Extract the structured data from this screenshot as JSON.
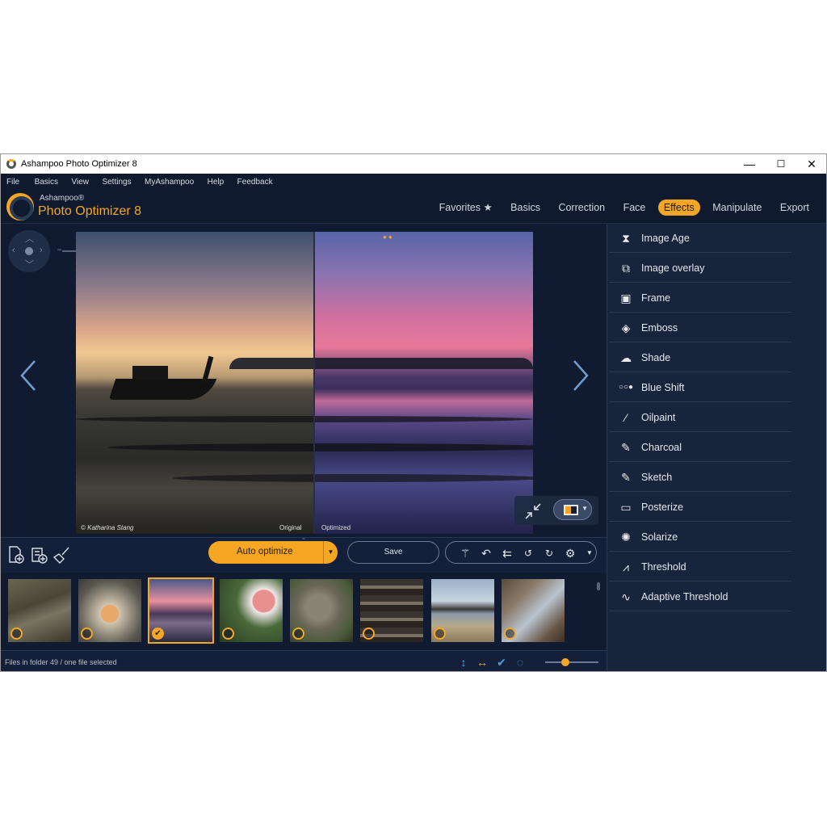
{
  "window": {
    "title": "Ashampoo Photo Optimizer 8",
    "minimize": "—",
    "maximize": "☐",
    "close": "✕"
  },
  "menu": [
    "File",
    "Basics",
    "View",
    "Settings",
    "MyAshampoo",
    "Help",
    "Feedback"
  ],
  "brand": {
    "top": "Ashampoo®",
    "name": "Photo Optimizer 8"
  },
  "tabs": [
    "Favorites ★",
    "Basics",
    "Correction",
    "Face",
    "Effects",
    "Manipulate",
    "Export"
  ],
  "active_tab": "Effects",
  "viewer": {
    "original_label": "Original",
    "optimized_label": "Optimized",
    "copyright": "© Katharina Stang",
    "zoom_minus": "−",
    "zoom_plus": "+"
  },
  "effects": [
    {
      "label": "Image Age",
      "icon": "hourglass-icon"
    },
    {
      "label": "Image overlay",
      "icon": "image-overlay-icon"
    },
    {
      "label": "Frame",
      "icon": "frame-icon"
    },
    {
      "label": "Emboss",
      "icon": "emboss-icon"
    },
    {
      "label": "Shade",
      "icon": "cloud-shade-icon"
    },
    {
      "label": "Blue Shift",
      "icon": "dots-icon"
    },
    {
      "label": "Oilpaint",
      "icon": "brush-icon"
    },
    {
      "label": "Charcoal",
      "icon": "pencil-icon"
    },
    {
      "label": "Sketch",
      "icon": "pencil-icon"
    },
    {
      "label": "Posterize",
      "icon": "posterize-icon"
    },
    {
      "label": "Solarize",
      "icon": "solarize-icon"
    },
    {
      "label": "Threshold",
      "icon": "chart-icon"
    },
    {
      "label": "Adaptive Threshold",
      "icon": "wave-chart-icon"
    }
  ],
  "toolbar": {
    "auto_optimize": "Auto optimize",
    "save": "Save"
  },
  "status": {
    "text": "Files in folder 49 / one file selected"
  },
  "colors": {
    "accent": "#f5a623",
    "background": "#14203a",
    "panel": "#18243c"
  }
}
